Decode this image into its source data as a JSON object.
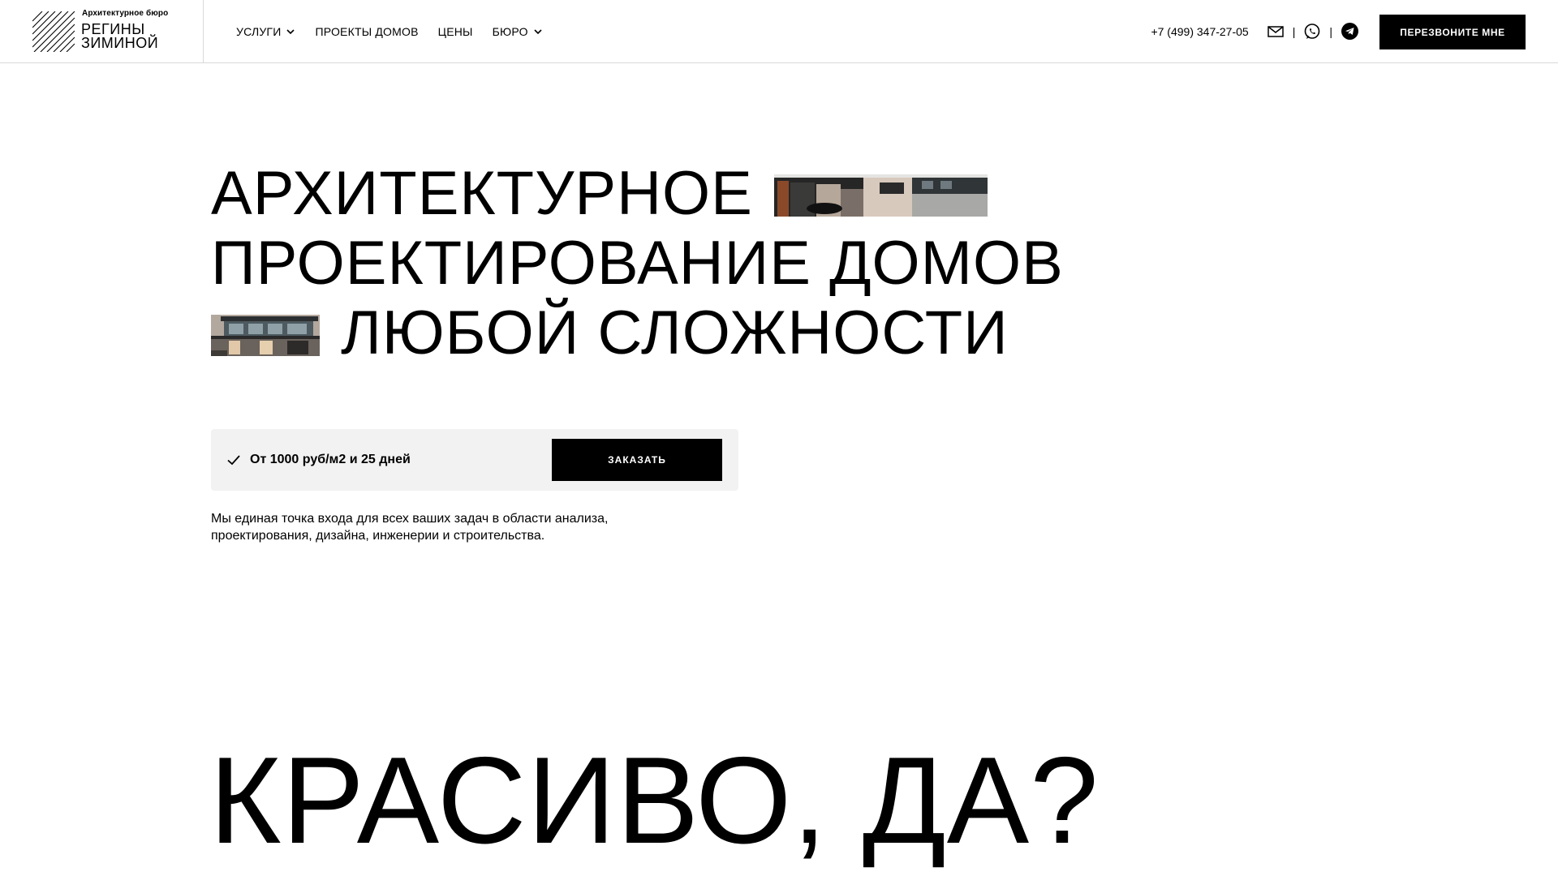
{
  "header": {
    "logo_small": "Архитектурное бюро",
    "logo_line1": "Регины",
    "logo_line2": "Зиминой",
    "nav": [
      {
        "label": "УСЛУГИ",
        "has_dropdown": true
      },
      {
        "label": "ПРОЕКТЫ ДОМОВ",
        "has_dropdown": false
      },
      {
        "label": "ЦЕНЫ",
        "has_dropdown": false
      },
      {
        "label": "БЮРО",
        "has_dropdown": true
      }
    ],
    "phone": "+7 (499) 347-27-05",
    "separator": "|",
    "icons": [
      "mail-icon",
      "whatsapp-icon",
      "telegram-icon"
    ],
    "callback_label": "ПЕРЕЗВОНИТЕ МНЕ"
  },
  "hero": {
    "title_line1": "АРХИТЕКТУРНОЕ",
    "title_line2": "ПРОЕКТИРОВАНИЕ ДОМОВ",
    "title_line3": "ЛЮБОЙ СЛОЖНОСТИ",
    "offer_text": "От 1000 руб/м2 и 25 дней",
    "order_label": "ЗАКАЗАТЬ",
    "description": "Мы единая точка входа для всех ваших задач в области анализа, проектирования, дизайна, инженерии и строительства."
  },
  "section": {
    "big_title": "КРАСИВО, ДА?"
  },
  "colors": {
    "accent": "#000000",
    "background": "#ffffff",
    "offer_bg": "#f2f2f2",
    "divider": "#d9d9d9"
  }
}
